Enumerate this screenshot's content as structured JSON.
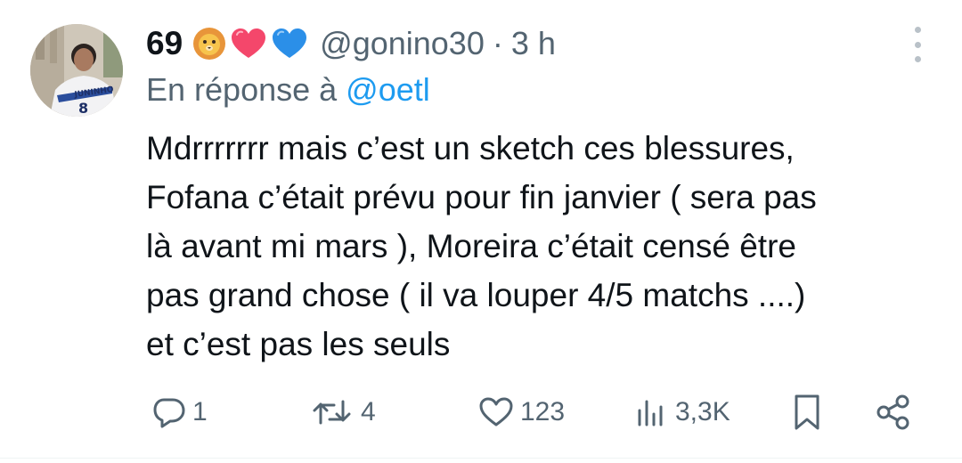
{
  "tweet": {
    "author": {
      "display_name": "69",
      "emojis": [
        "lion-face",
        "pink-heart",
        "blue-heart"
      ],
      "handle": "@gonino30",
      "separator": "·",
      "time": "3 h",
      "avatar_icon": "profile-photo"
    },
    "reply": {
      "prefix": "En réponse à ",
      "handle": "@oetl"
    },
    "text_lines": [
      "Mdrrrrrrr mais c’est un sketch ces blessures,",
      "Fofana c’était prévu pour fin janvier ( sera pas",
      "là avant mi mars ), Moreira c’était censé être",
      "pas grand chose ( il va louper 4/5 matchs ....)",
      "et c’est pas les seuls"
    ],
    "actions": {
      "reply_count": "1",
      "retweet_count": "4",
      "like_count": "123",
      "views_count": "3,3K"
    }
  },
  "colors": {
    "text": "#0f1419",
    "secondary": "#536471",
    "accent": "#1d9bf0"
  }
}
